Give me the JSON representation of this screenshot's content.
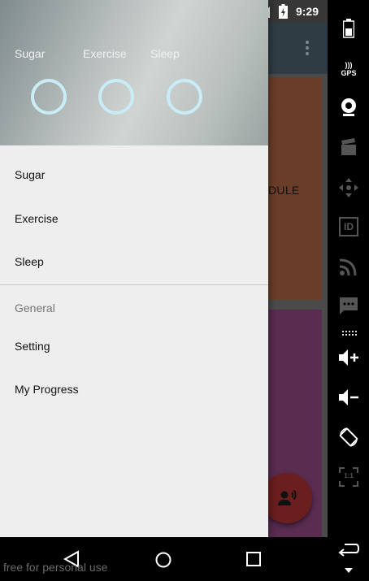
{
  "status_bar": {
    "time": "9:29"
  },
  "background_app": {
    "card_label": "DULE"
  },
  "drawer": {
    "header_metrics": [
      {
        "label": "Sugar"
      },
      {
        "label": "Exercise"
      },
      {
        "label": "Sleep"
      }
    ],
    "items": [
      {
        "label": "Sugar"
      },
      {
        "label": "Exercise"
      },
      {
        "label": "Sleep"
      }
    ],
    "section_title": "General",
    "secondary_items": [
      {
        "label": "Setting"
      },
      {
        "label": "My Progress"
      }
    ]
  },
  "watermark": "free for personal use",
  "emulator_buttons": [
    "battery-icon",
    "gps-icon",
    "camera-icon",
    "clapperboard-icon",
    "dpad-icon",
    "id-icon",
    "cast-icon",
    "sms-icon",
    "volume-up-icon",
    "volume-down-icon",
    "rotate-icon",
    "scale-icon",
    "back-icon",
    "menu-down-icon"
  ],
  "emulator_gps_label": "GPS",
  "emulator_id_label": "ID",
  "emulator_scale_label": "1:1",
  "colors": {
    "drawer_bg": "#eeeeee",
    "ring": "#c9ecf7",
    "toolbar": "#2f3c43",
    "card_top": "#6a3d28",
    "card_bottom": "#5a2c50",
    "fab": "#6b1e1e"
  }
}
